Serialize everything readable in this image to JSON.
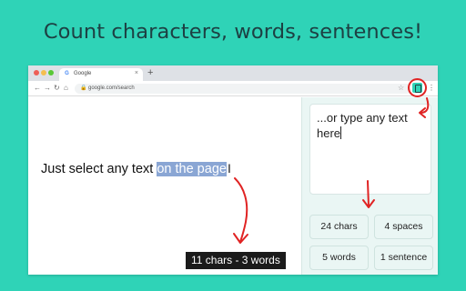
{
  "headline": "Count characters, words, sentences!",
  "browser": {
    "tab_title": "Google",
    "tab_favicon": "G",
    "tab_close": "×",
    "new_tab": "+",
    "url": "google.com/search",
    "nav": {
      "back": "←",
      "forward": "→",
      "reload": "↻",
      "home": "⌂"
    },
    "star": "☆",
    "kebab": "⋮"
  },
  "page": {
    "text_plain": "Just select any text ",
    "text_selected": "on the page",
    "cursor": "I"
  },
  "selection_counter": "11 chars  -  3 words",
  "panel": {
    "textarea_value": "...or type any text here",
    "stats": [
      "24 chars",
      "4 spaces",
      "5 words",
      "1 sentence"
    ]
  },
  "colors": {
    "background": "#2fd3b7",
    "headline": "#1d4043",
    "annotation": "#e02323",
    "selection": "#8aa6d4",
    "panel": "#eaf6f4"
  },
  "icons": [
    "chrome-traffic-lights",
    "google-favicon",
    "lock-icon",
    "star-icon",
    "extension-icon",
    "kebab-menu-icon",
    "red-arrow-annotation"
  ]
}
